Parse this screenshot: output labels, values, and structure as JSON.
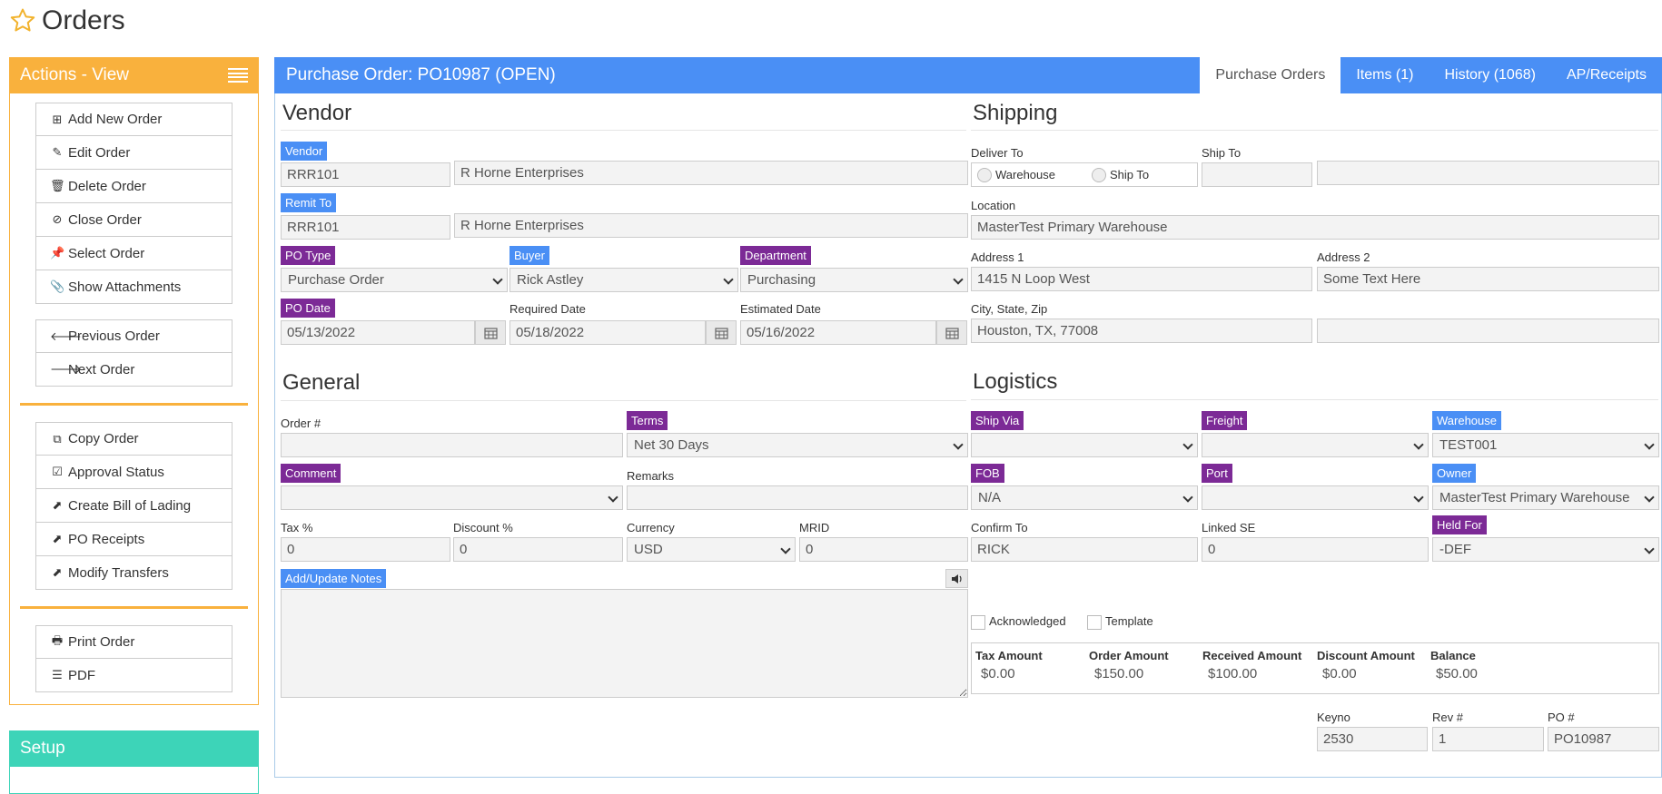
{
  "page": {
    "title": "Orders",
    "icon": "star-icon"
  },
  "sidebar": {
    "actions_title": "Actions - View",
    "group1": [
      {
        "label": "Add New Order",
        "icon": "plus-square-icon"
      },
      {
        "label": "Edit Order",
        "icon": "pencil-icon"
      },
      {
        "label": "Delete Order",
        "icon": "trash-icon"
      },
      {
        "label": "Close Order",
        "icon": "ban-icon"
      },
      {
        "label": "Select Order",
        "icon": "pin-icon"
      },
      {
        "label": "Show Attachments",
        "icon": "paperclip-icon"
      }
    ],
    "group2": [
      {
        "label": "Previous Order",
        "icon": "arrow-left-icon"
      },
      {
        "label": "Next Order",
        "icon": "arrow-right-icon"
      }
    ],
    "group3": [
      {
        "label": "Copy Order",
        "icon": "copy-icon"
      },
      {
        "label": "Approval Status",
        "icon": "check-square-icon"
      },
      {
        "label": "Create Bill of Lading",
        "icon": "external-link-icon"
      },
      {
        "label": "PO Receipts",
        "icon": "external-link-icon"
      },
      {
        "label": "Modify Transfers",
        "icon": "external-link-icon"
      }
    ],
    "group4": [
      {
        "label": "Print Order",
        "icon": "printer-icon"
      },
      {
        "label": "PDF",
        "icon": "list-icon"
      }
    ],
    "setup_title": "Setup"
  },
  "main": {
    "title": "Purchase Order: PO10987 (OPEN)",
    "tabs": [
      "Purchase Orders",
      "Items (1)",
      "History (1068)",
      "AP/Receipts"
    ],
    "vendor": {
      "section_title": "Vendor",
      "vendor_label": "Vendor",
      "vendor_code": "RRR101",
      "vendor_name": "R Horne Enterprises",
      "remit_label": "Remit To",
      "remit_code": "RRR101",
      "remit_name": "R Horne Enterprises",
      "po_type_label": "PO Type",
      "po_type": "Purchase Order",
      "buyer_label": "Buyer",
      "buyer": "Rick Astley",
      "department_label": "Department",
      "department": "Purchasing",
      "po_date_label": "PO Date",
      "po_date": "05/13/2022",
      "required_date_label": "Required Date",
      "required_date": "05/18/2022",
      "estimated_date_label": "Estimated Date",
      "estimated_date": "05/16/2022"
    },
    "shipping": {
      "section_title": "Shipping",
      "deliver_to_label": "Deliver To",
      "opt_warehouse": "Warehouse",
      "opt_ship_to": "Ship To",
      "ship_to_label": "Ship To",
      "ship_to_code": "",
      "ship_to_name": "",
      "location_label": "Location",
      "location": "MasterTest Primary Warehouse",
      "address1_label": "Address 1",
      "address1": "1415 N Loop West",
      "address2_label": "Address 2",
      "address2": "Some Text Here",
      "csz_label": "City, State, Zip",
      "csz": "Houston, TX, 77008",
      "csz_extra": ""
    },
    "general": {
      "section_title": "General",
      "order_no_label": "Order #",
      "order_no": "",
      "terms_label": "Terms",
      "terms": "Net 30 Days",
      "comment_label": "Comment",
      "comment": "",
      "remarks_label": "Remarks",
      "remarks": "",
      "tax_label": "Tax %",
      "tax": "0",
      "discount_label": "Discount %",
      "discount": "0",
      "currency_label": "Currency",
      "currency": "USD",
      "mrid_label": "MRID",
      "mrid": "0",
      "notes_label": "Add/Update Notes"
    },
    "logistics": {
      "section_title": "Logistics",
      "ship_via_label": "Ship Via",
      "ship_via": "",
      "freight_label": "Freight",
      "freight": "",
      "warehouse_label": "Warehouse",
      "warehouse": "TEST001",
      "fob_label": "FOB",
      "fob": "N/A",
      "port_label": "Port",
      "port": "",
      "owner_label": "Owner",
      "owner": "MasterTest Primary Warehouse",
      "confirm_to_label": "Confirm To",
      "confirm_to": "RICK",
      "linked_se_label": "Linked SE",
      "linked_se": "0",
      "held_for_label": "Held For",
      "held_for": "-DEF",
      "acknowledged_label": "Acknowledged",
      "template_label": "Template"
    },
    "totals": {
      "tax_amount_label": "Tax Amount",
      "tax_amount": "$0.00",
      "order_amount_label": "Order Amount",
      "order_amount": "$150.00",
      "received_amount_label": "Received Amount",
      "received_amount": "$100.00",
      "discount_amount_label": "Discount Amount",
      "discount_amount": "$0.00",
      "balance_label": "Balance",
      "balance": "$50.00"
    },
    "footer": {
      "keyno_label": "Keyno",
      "keyno": "2530",
      "rev_label": "Rev #",
      "rev": "1",
      "po_label": "PO #",
      "po": "PO10987"
    }
  },
  "colors": {
    "orange": "#f9b13d",
    "blue": "#4a8ff5",
    "purple": "#7c2a96",
    "teal": "#3dd4b8"
  }
}
